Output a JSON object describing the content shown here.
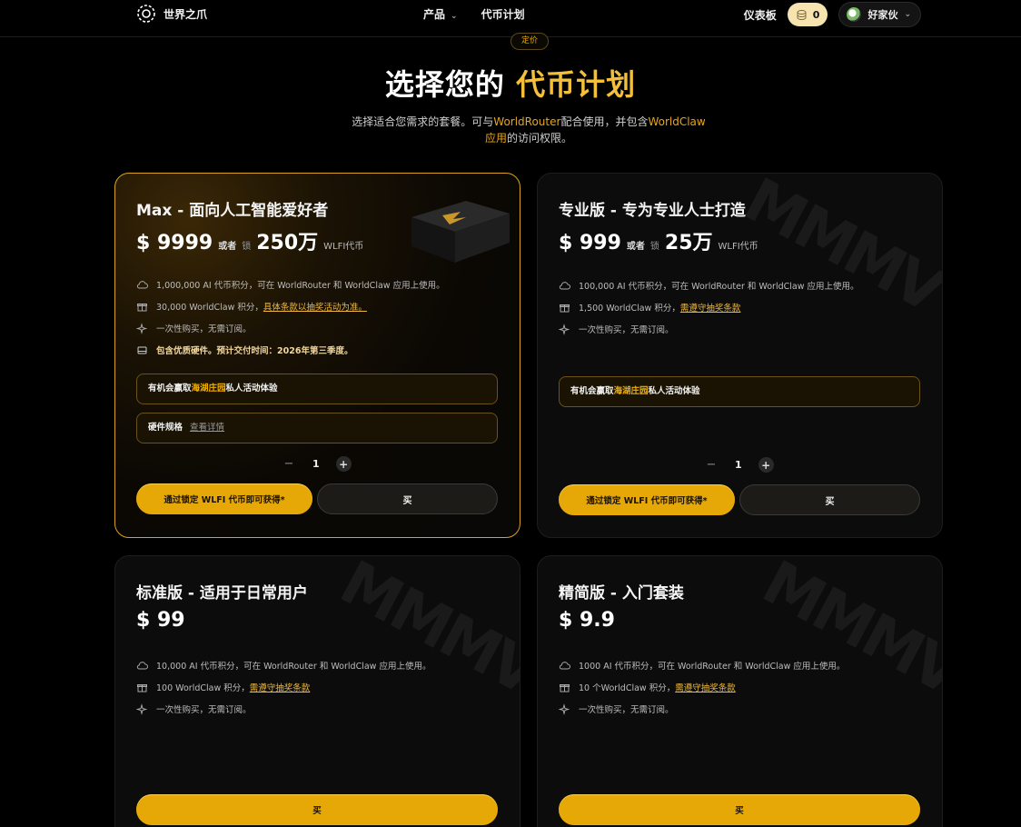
{
  "nav": {
    "brand": "世界之爪",
    "product": "产品",
    "coin_plans": "代币计划",
    "dashboard": "仪表板",
    "coin_balance": "0",
    "username": "好家伙"
  },
  "hero": {
    "badge": "定价",
    "title_main": "选择您的",
    "title_accent": "代币计划",
    "sub_1": "选择适合您需求的套餐。可与",
    "sub_worldrouter": "WorldRouter",
    "sub_2": "配合使用，并包含",
    "sub_worldclaw": "WorldClaw",
    "sub_app": "应用",
    "sub_3": "的访问权限。"
  },
  "plans": {
    "max": {
      "title": "Max - 面向人工智能爱好者",
      "price": "$ 9999",
      "or": "或者",
      "lock": "锁",
      "lock_amount": "250万",
      "unit": "WLFI代币",
      "f1": "1,000,000 AI 代币积分，可在 WorldRouter 和 WorldClaw 应用上使用。",
      "f2_text": "30,000 WorldClaw 积分，",
      "f2_link": "具体条款以抽奖活动为准。",
      "f3": "一次性购买，无需订阅。",
      "f4": "包含优质硬件。预计交付时间：2026年第三季度。",
      "box1_a": "有机会赢取",
      "box1_gold": "海湖庄园",
      "box1_b": "私人活动体验",
      "box2_label": "硬件规格",
      "box2_link": "查看详情",
      "qty": "1",
      "lock_button": "通过锁定 WLFI 代币即可获得*",
      "buy_button": "买"
    },
    "pro": {
      "title": "专业版 - 专为专业人士打造",
      "price": "$ 999",
      "or": "或者",
      "lock": "锁",
      "lock_amount": "25万",
      "unit": "WLFI代币",
      "f1": "100,000 AI 代币积分，可在 WorldRouter 和 WorldClaw 应用上使用。",
      "f2_text": "1,500 WorldClaw 积分，",
      "f2_link": "需遵守抽奖条款",
      "f3": "一次性购买，无需订阅。",
      "box1_a": "有机会赢取",
      "box1_gold": "海湖庄园",
      "box1_b": "私人活动体验",
      "qty": "1",
      "lock_button": "通过锁定 WLFI 代币即可获得*",
      "buy_button": "买"
    },
    "standard": {
      "title": "标准版 - 适用于日常用户",
      "price": "$ 99",
      "f1": "10,000 AI 代币积分，可在 WorldRouter 和 WorldClaw 应用上使用。",
      "f2_text": "100 WorldClaw 积分，",
      "f2_link": "需遵守抽奖条款",
      "f3": "一次性购买，无需订阅。",
      "buy_button": "买"
    },
    "lite": {
      "title": "精简版 - 入门套装",
      "price": "$ 9.9",
      "f1": "1000 AI 代币积分，可在 WorldRouter 和 WorldClaw 应用上使用。",
      "f2_text": "10 个WorldClaw 积分，",
      "f2_link": "需遵守抽奖条款",
      "f3": "一次性购买，无需订阅。",
      "buy_button": "买"
    }
  },
  "colors": {
    "accent_gold": "#e6a806",
    "title_gold": "#f4bf3a",
    "background": "#000000",
    "card": "#0c0c0c"
  },
  "icons": [
    "logo-icon",
    "chevron-down-icon",
    "coins-icon",
    "cloud-icon",
    "gift-icon",
    "sparkles-icon",
    "hardware-icon",
    "minus-icon",
    "plus-icon"
  ]
}
